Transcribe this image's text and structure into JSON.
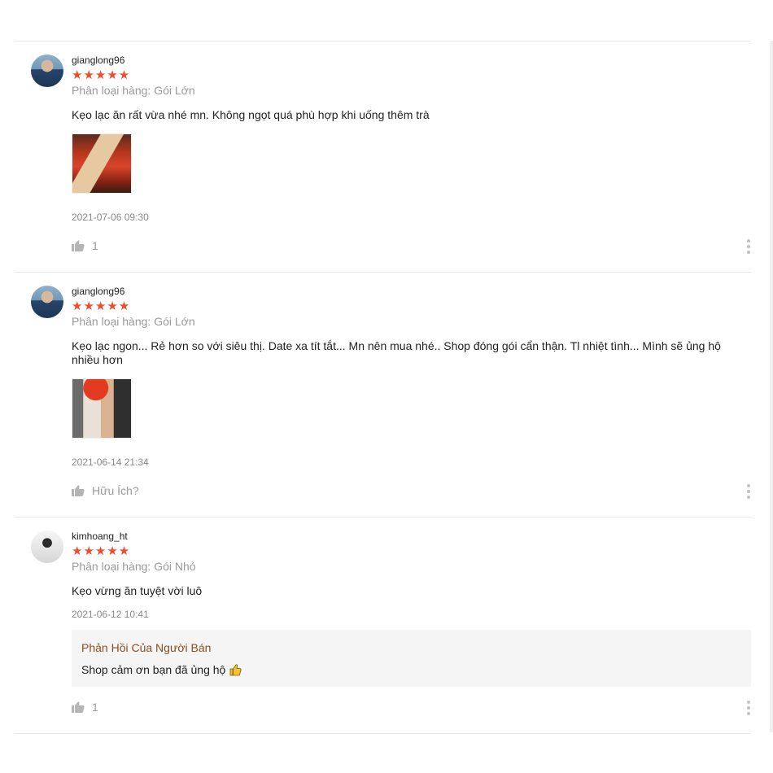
{
  "reviews": [
    {
      "username": "gianglong96",
      "rating": 5,
      "stars": "★★★★★",
      "variation": "Phân loại hàng: Gói Lớn",
      "comment": "Kẹo lạc ăn rất vừa nhé mn. Không ngọt quá phù hợp khi uống thêm trà",
      "date": "2021-07-06 09:30",
      "like_text": "1"
    },
    {
      "username": "gianglong96",
      "rating": 5,
      "stars": "★★★★★",
      "variation": "Phân loại hàng: Gói Lớn",
      "comment": "Kẹo lạc ngon... Rẻ hơn so với siêu thị. Date xa tít tắt... Mn nên mua nhé.. Shop đóng gói cẩn thận. Tl nhiệt tình... Mình sẽ ủng hộ nhiều hơn",
      "date": "2021-06-14 21:34",
      "like_text": "Hữu Ích?"
    },
    {
      "username": "kimhoang_ht",
      "rating": 5,
      "stars": "★★★★★",
      "variation": "Phân loại hàng: Gói Nhỏ",
      "comment": "Kẹo vừng ăn tuyệt vời luô",
      "date": "2021-06-12 10:41",
      "seller_reply": {
        "title": "Phản Hồi Của Người Bán",
        "text": "Shop cảm ơn bạn đã ủng hộ"
      },
      "like_text": "1"
    }
  ],
  "colors": {
    "star": "#ee4d2d",
    "seller_title": "#8a4d1e",
    "muted": "#9a9a9a"
  },
  "icons": [
    "thumbs-up-icon",
    "more-vertical-icon",
    "thumbs-up-emoji"
  ]
}
